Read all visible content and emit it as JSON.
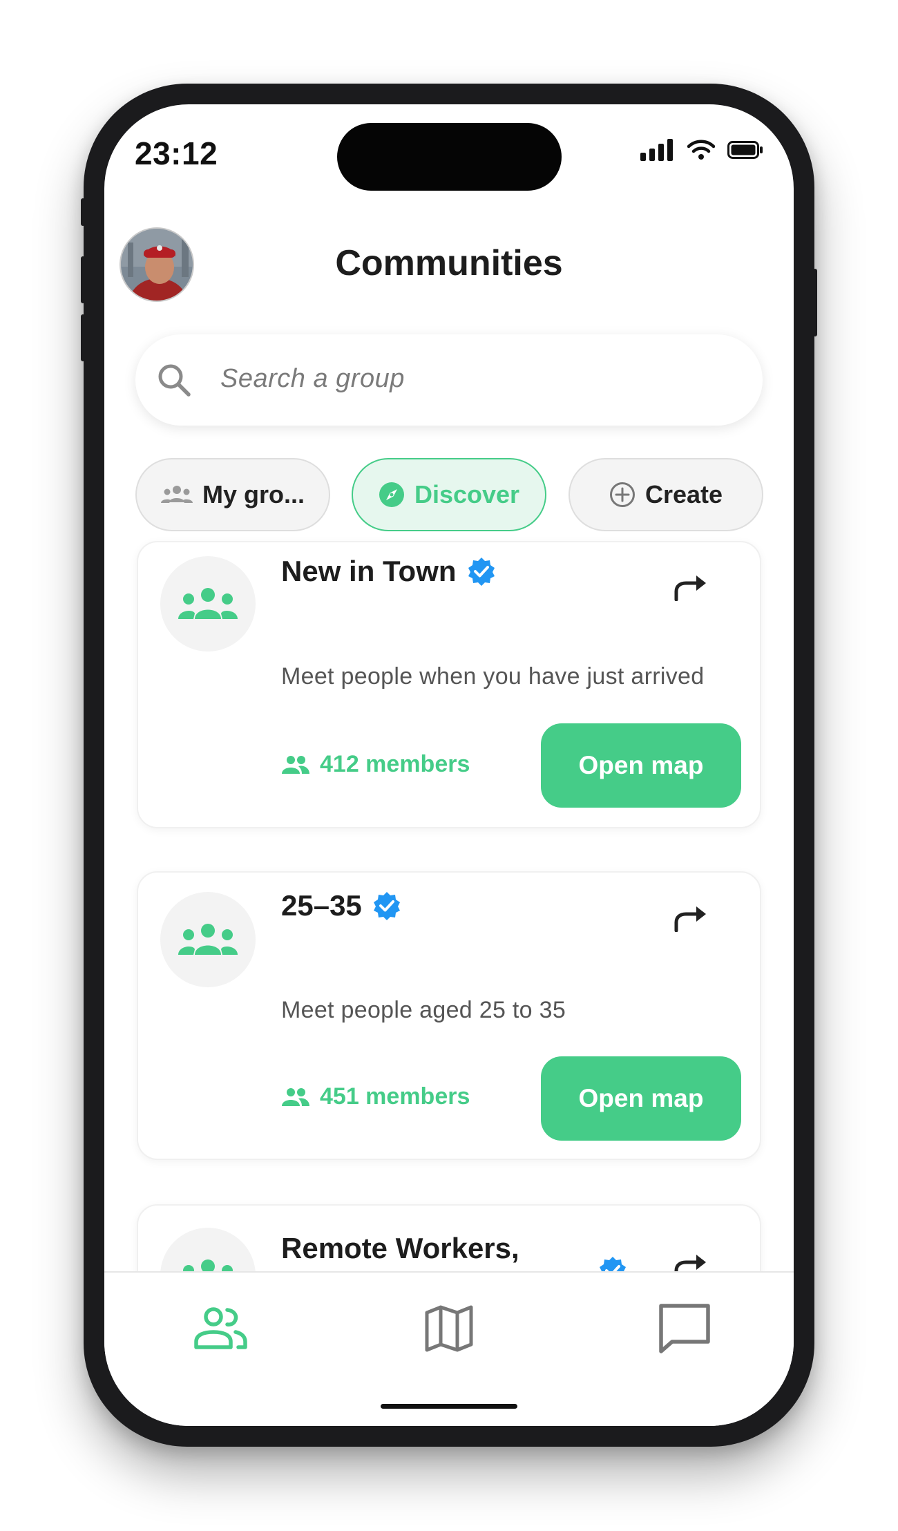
{
  "status_bar": {
    "time": "23:12"
  },
  "header": {
    "title": "Communities"
  },
  "search": {
    "placeholder": "Search a group"
  },
  "tabs": [
    {
      "label": "My gro...",
      "icon": "group-icon",
      "active": false
    },
    {
      "label": "Discover",
      "icon": "compass-icon",
      "active": true
    },
    {
      "label": "Create",
      "icon": "plus-circle-icon",
      "active": false
    }
  ],
  "groups": [
    {
      "name": "New in Town",
      "description": "Meet people when you have just arrived",
      "members": "412 members",
      "action": "Open map",
      "verified": true
    },
    {
      "name": "25–35",
      "description": "Meet people aged 25 to 35",
      "members": "451 members",
      "action": "Open map",
      "verified": true
    },
    {
      "name": "Remote Workers,",
      "verified": true
    }
  ],
  "bottom_nav": [
    {
      "icon": "communities-icon",
      "active": true
    },
    {
      "icon": "map-icon",
      "active": false
    },
    {
      "icon": "chat-icon",
      "active": false
    }
  ],
  "colors": {
    "accent": "#45cc88",
    "verified": "#2196f3",
    "frame": "#1b1b1d"
  }
}
